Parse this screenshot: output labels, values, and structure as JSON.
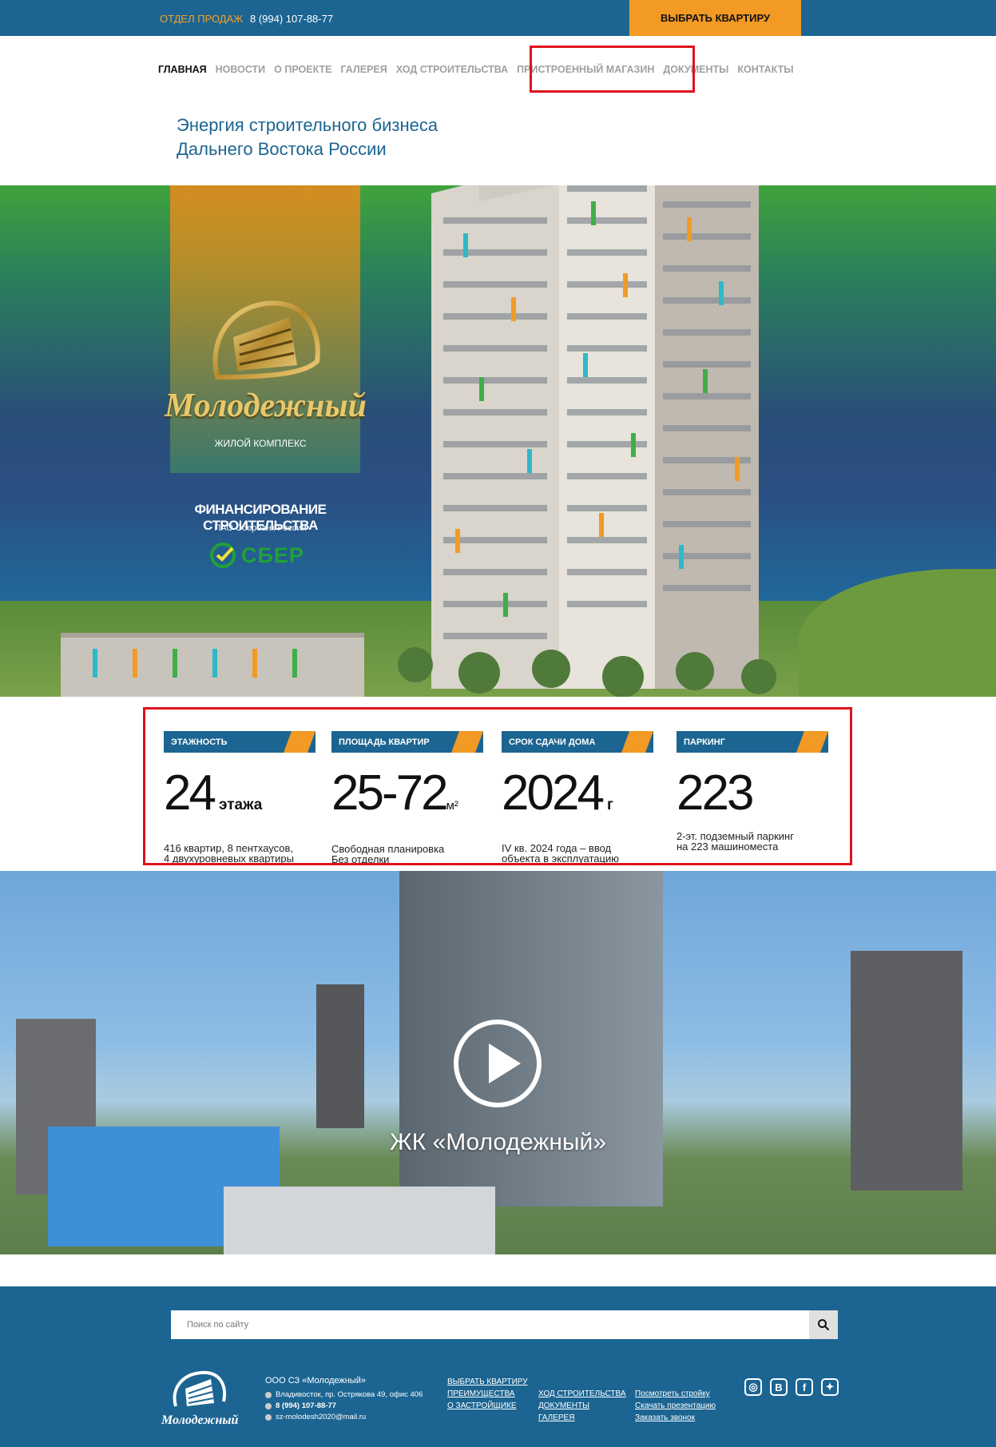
{
  "topbar": {
    "sales_label": "ОТДЕЛ ПРОДАЖ",
    "phone": "8 (994) 107-88-77",
    "cta": "ВЫБРАТЬ КВАРТИРУ"
  },
  "nav": [
    "ГЛАВНАЯ",
    "НОВОСТИ",
    "О ПРОЕКТЕ",
    "ГАЛЕРЕЯ",
    "ХОД СТРОИТЕЛЬСТВА",
    "ПРИСТРОЕННЫЙ МАГАЗИН",
    "ДОКУМЕНТЫ",
    "КОНТАКТЫ"
  ],
  "tagline": {
    "line1": "Энергия строительного бизнеса",
    "line2": "Дальнего Востока России"
  },
  "hero": {
    "logo_name": "Молодежный",
    "logo_sub": "ЖИЛОЙ КОМПЛЕКС",
    "financing": "ФИНАНСИРОВАНИЕ СТРОИТЕЛЬСТВА",
    "bank": "ПАО Сбербанк России",
    "sber": "СБЕР"
  },
  "stats": [
    {
      "label": "ЭТАЖНОСТЬ",
      "value": "24",
      "unit": "этажа",
      "desc": "416 квартир, 8 пентхаусов,\n4 двухуровневых квартиры"
    },
    {
      "label": "ПЛОЩАДЬ КВАРТИР",
      "value": "25-72",
      "unit": "м²",
      "desc": "Свободная планировка\nБез отделки"
    },
    {
      "label": "СРОК СДАЧИ ДОМА",
      "value": "2024",
      "unit": "г",
      "desc": "IV кв.  2024 года – ввод\nобъекта в эксплуатацию"
    },
    {
      "label": "ПАРКИНГ",
      "value": "223",
      "unit": "",
      "desc": "2-эт. подземный паркинг\nна 223 машиноместа"
    }
  ],
  "video": {
    "title": "ЖК «Молодежный»"
  },
  "footer": {
    "search_placeholder": "Поиск по сайту",
    "company": "ООО СЗ «Молодежный»",
    "address": "Владивосток, пр. Острякова 49, офис 406",
    "phone": "8 (994) 107-88-77",
    "email": "sz-molodesh2020@mail.ru",
    "logo_text": "Молодежный",
    "col1": [
      "ВЫБРАТЬ КВАРТИРУ",
      "ПРЕИМУЩЕСТВА",
      "О ЗАСТРОЙЩИКЕ"
    ],
    "col2": [
      "ХОД СТРОИТЕЛЬСТВА",
      "ДОКУМЕНТЫ",
      "ГАЛЕРЕЯ"
    ],
    "col3": [
      "Посмотреть стройку",
      "Скачать презентацию",
      "Заказать звонок"
    ],
    "social": [
      "instagram-icon",
      "vk-icon",
      "facebook-icon",
      "twitter-icon"
    ]
  }
}
